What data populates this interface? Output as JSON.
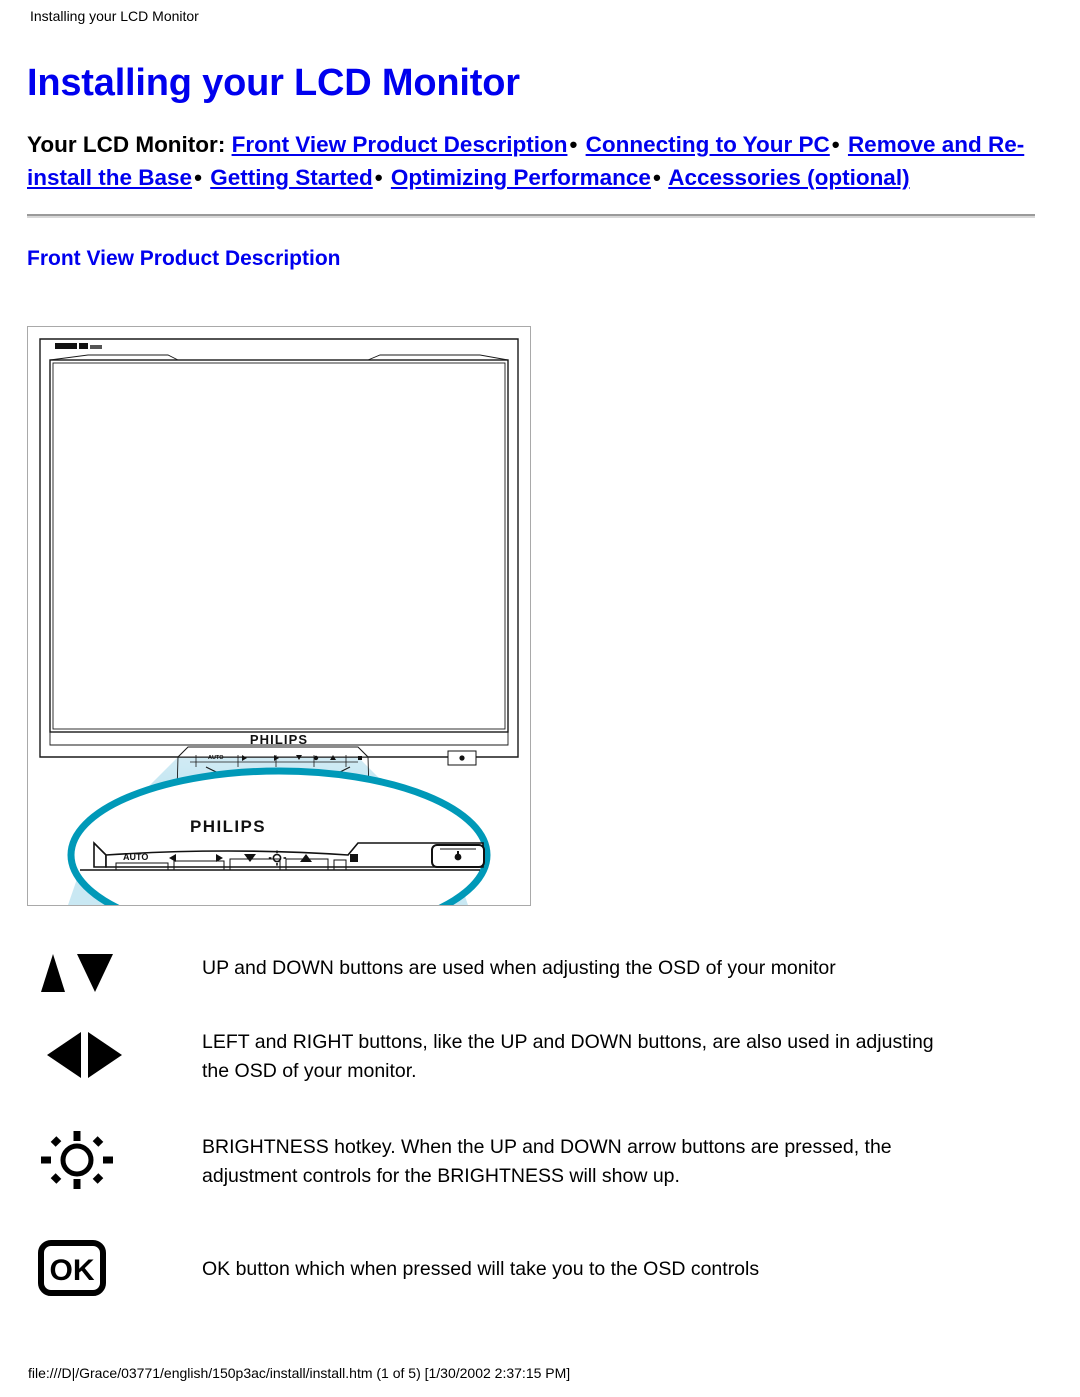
{
  "document": {
    "running_header": "Installing your LCD Monitor",
    "title": "Installing your LCD Monitor",
    "section_title": "Front View Product Description",
    "footer_path": "file:///D|/Grace/03771/english/150p3ac/install/install.htm (1 of 5) [1/30/2002 2:37:15 PM]"
  },
  "colors": {
    "link": "#0000EE",
    "heading": "#0000EE",
    "text": "#000000",
    "callout_ring": "#0099B8",
    "beam_light": "#CFEAF4",
    "beam_mid": "#9FD8EA",
    "rule": "#9A9A9A"
  },
  "nav": {
    "label": "Your LCD Monitor",
    "separator": ":",
    "bullet": "•",
    "links": [
      "Front View Product Description",
      "Connecting to Your PC",
      "Remove and Re-install the Base",
      "Getting Started",
      "Optimizing Performance",
      "Accessories (optional)"
    ]
  },
  "figure": {
    "alt": "Philips LCD monitor front view with magnified control panel callout",
    "brand": "PHILIPS",
    "brand_small": "PHILIPS",
    "control_labels": {
      "auto": "AUTO",
      "left": "◄",
      "right": "►",
      "down": "▼",
      "brightness": "☼",
      "up": "▲",
      "menu": "■",
      "power": "⏻"
    }
  },
  "legend": [
    {
      "icon": "up-down-arrows-icon",
      "text": "UP and DOWN buttons are used when adjusting the OSD of your monitor"
    },
    {
      "icon": "left-right-arrows-icon",
      "text": "LEFT and RIGHT buttons, like the UP and DOWN buttons, are also used in adjusting the OSD of your monitor."
    },
    {
      "icon": "brightness-sun-icon",
      "text": "BRIGHTNESS hotkey. When the UP and DOWN arrow buttons are pressed, the adjustment controls for the BRIGHTNESS will show up."
    },
    {
      "icon": "ok-button-icon",
      "text": "OK button which when pressed will take you to the OSD controls"
    }
  ]
}
